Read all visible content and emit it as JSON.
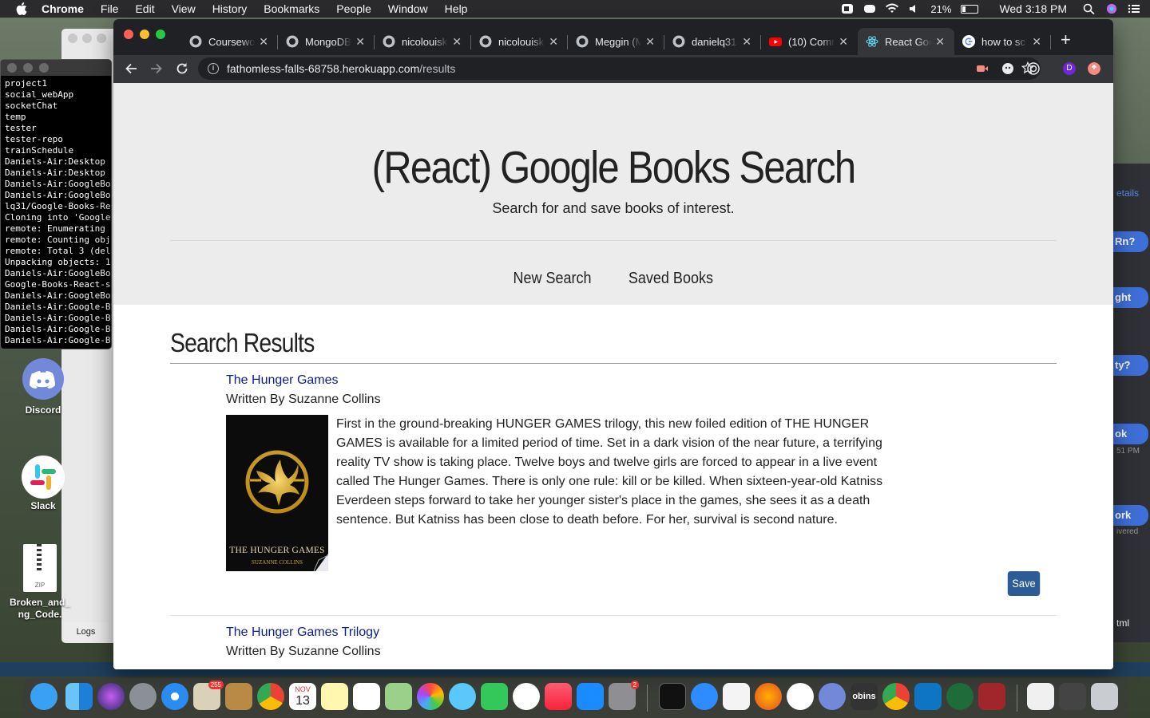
{
  "menubar": {
    "app_name": "Chrome",
    "menus": [
      "File",
      "Edit",
      "View",
      "History",
      "Bookmarks",
      "People",
      "Window",
      "Help"
    ],
    "battery": "21%",
    "clock": "Wed 3:18 PM"
  },
  "terminal": {
    "lines": [
      "project1",
      "social_webApp",
      "socketChat",
      "temp",
      "tester",
      "tester-repo",
      "trainSchedule",
      "Daniels-Air:Desktop",
      "Daniels-Air:Desktop",
      "Daniels-Air:GoogleBo",
      "Daniels-Air:GoogleBo",
      "lq31/Google-Books-Re",
      "Cloning into 'Google",
      "remote: Enumerating",
      "remote: Counting obj",
      "remote: Total 3 (del",
      "Unpacking objects: 1",
      "Daniels-Air:GoogleBo",
      "Google-Books-React-s",
      "Daniels-Air:GoogleBo",
      "Daniels-Air:Google-B",
      "Daniels-Air:Google-B",
      "Daniels-Air:Google-B",
      "Daniels-Air:Google-B"
    ]
  },
  "desktop": {
    "discord": "Discord",
    "slack": "Slack",
    "zip_file": "Broken_and_\nng_Code.",
    "zip_tag": "ZIP",
    "logs": "Logs"
  },
  "right_window": {
    "snippets": [
      "etails",
      "Rn?",
      "ght",
      "ty?",
      "ok",
      "51 PM",
      "ork",
      "ivered",
      "tml"
    ]
  },
  "browser": {
    "tabs": [
      {
        "title": "Coursewo",
        "icon": "github-icon"
      },
      {
        "title": "MongoDB",
        "icon": "github-icon"
      },
      {
        "title": "nicolouisk",
        "icon": "github-icon"
      },
      {
        "title": "nicolouisk",
        "icon": "github-icon"
      },
      {
        "title": "Meggin (M",
        "icon": "github-icon"
      },
      {
        "title": "danielq31/",
        "icon": "github-icon"
      },
      {
        "title": "(10) Comr",
        "icon": "youtube-icon"
      },
      {
        "title": "React Goo",
        "icon": "react-icon"
      },
      {
        "title": "how to sc",
        "icon": "google-icon"
      }
    ],
    "active_tab_index": 7,
    "url_host": "fathomless-falls-68758.herokuapp.com",
    "url_path": "/results",
    "profile_initial": "D"
  },
  "page": {
    "title": "(React) Google Books Search",
    "subtitle": "Search for and save books of interest.",
    "nav": {
      "new_search": "New Search",
      "saved_books": "Saved Books"
    },
    "results_heading": "Search Results",
    "books": [
      {
        "title": "The Hunger Games",
        "author": "Written By Suzanne Collins",
        "cover_title": "THE HUNGER GAMES",
        "cover_author": "SUZANNE COLLINS",
        "description": "First in the ground-breaking HUNGER GAMES trilogy, this new foiled edition of THE HUNGER GAMES is available for a limited period of time. Set in a dark vision of the near future, a terrifying reality TV show is taking place. Twelve boys and twelve girls are forced to appear in a live event called The Hunger Games. There is only one rule: kill or be killed. When sixteen-year-old Katniss Everdeen steps forward to take her younger sister's place in the games, she sees it as a death sentence. But Katniss has been close to death before. For her, survival is second nature.",
        "save_label": "Save"
      },
      {
        "title": "The Hunger Games Trilogy",
        "author": "Written By Suzanne Collins"
      }
    ]
  },
  "dock": {
    "mail_badge": "255",
    "calendar_month": "NOV",
    "calendar_day": "13",
    "prefs_badge": "2",
    "obins_label": "obins"
  }
}
